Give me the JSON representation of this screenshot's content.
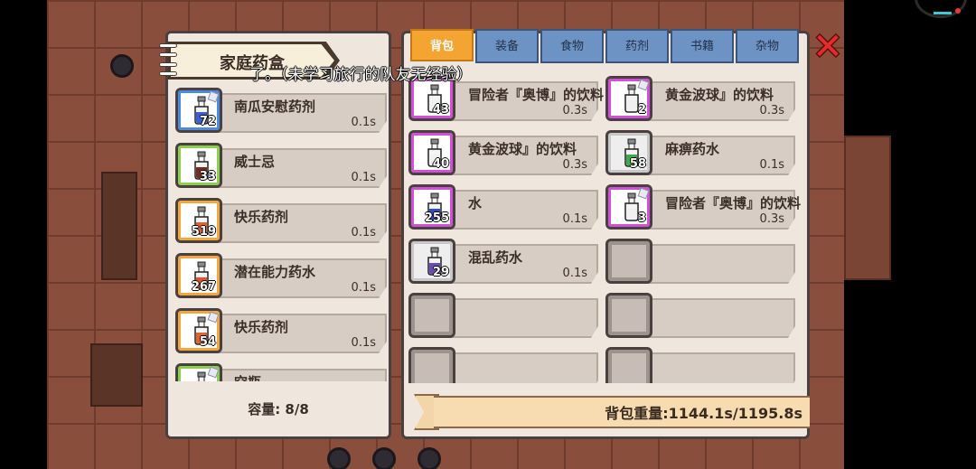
{
  "left_panel": {
    "title": "家庭药盒",
    "capacity": "容量: 8/8",
    "items": [
      {
        "name": "南瓜安慰药剂",
        "count": "72",
        "weight": "0.1s",
        "rarity": "blue",
        "potion_color": "#3b5fd6",
        "tagged": true
      },
      {
        "name": "威士忌",
        "count": "33",
        "weight": "0.1s",
        "rarity": "green",
        "potion_color": "#7a2a1e",
        "tagged": false
      },
      {
        "name": "快乐药剂",
        "count": "519",
        "weight": "0.1s",
        "rarity": "orange",
        "potion_color": "#e2622b",
        "tagged": false
      },
      {
        "name": "潜在能力药水",
        "count": "267",
        "weight": "0.1s",
        "rarity": "orange",
        "potion_color": "#e8502b",
        "tagged": false
      },
      {
        "name": "快乐药剂",
        "count": "54",
        "weight": "0.1s",
        "rarity": "orange",
        "potion_color": "#e2622b",
        "tagged": true
      },
      {
        "name": "空瓶",
        "count": "",
        "weight": "",
        "rarity": "green",
        "potion_color": "#8ccf4b",
        "tagged": true
      }
    ]
  },
  "tooltip": "了。（未学习旅行的队友无经验）",
  "right_panel": {
    "tabs": [
      {
        "label": "背包",
        "active": true
      },
      {
        "label": "装备",
        "active": false
      },
      {
        "label": "食物",
        "active": false
      },
      {
        "label": "药剂",
        "active": false
      },
      {
        "label": "书籍",
        "active": false
      },
      {
        "label": "杂物",
        "active": false
      }
    ],
    "close_icon": "close-icon",
    "items": [
      {
        "name": "冒险者『奥博』的饮料",
        "count": "43",
        "weight": "0.3s",
        "rarity": "purple",
        "potion_color": "#f0f0f0",
        "tagged": false
      },
      {
        "name": "黄金波球』的饮料",
        "count": "2",
        "weight": "0.3s",
        "rarity": "purple",
        "potion_color": "#f0f0f0",
        "tagged": true
      },
      {
        "name": "黄金波球』的饮料",
        "count": "40",
        "weight": "0.3s",
        "rarity": "purple",
        "potion_color": "#f0f0f0",
        "tagged": false
      },
      {
        "name": "麻痹药水",
        "count": "58",
        "weight": "0.1s",
        "rarity": "grey",
        "potion_color": "#3faa4a",
        "tagged": false
      },
      {
        "name": "水",
        "count": "255",
        "weight": "0.1s",
        "rarity": "purple",
        "potion_color": "#2d4fcf",
        "tagged": false
      },
      {
        "name": "冒险者『奥博』的饮料",
        "count": "3",
        "weight": "0.3s",
        "rarity": "purple",
        "potion_color": "#f0f0f0",
        "tagged": true
      },
      {
        "name": "混乱药水",
        "count": "29",
        "weight": "0.1s",
        "rarity": "grey",
        "potion_color": "#6a4bb8",
        "tagged": false
      },
      {
        "name": "",
        "count": "",
        "weight": "",
        "rarity": "empty",
        "potion_color": "",
        "tagged": false
      },
      {
        "name": "",
        "count": "",
        "weight": "",
        "rarity": "empty",
        "potion_color": "",
        "tagged": false
      },
      {
        "name": "",
        "count": "",
        "weight": "",
        "rarity": "empty",
        "potion_color": "",
        "tagged": false
      },
      {
        "name": "",
        "count": "",
        "weight": "",
        "rarity": "empty",
        "potion_color": "",
        "tagged": false
      },
      {
        "name": "",
        "count": "",
        "weight": "",
        "rarity": "empty",
        "potion_color": "",
        "tagged": false
      }
    ],
    "bag_weight": "背包重量:1144.1s/1195.8s"
  }
}
